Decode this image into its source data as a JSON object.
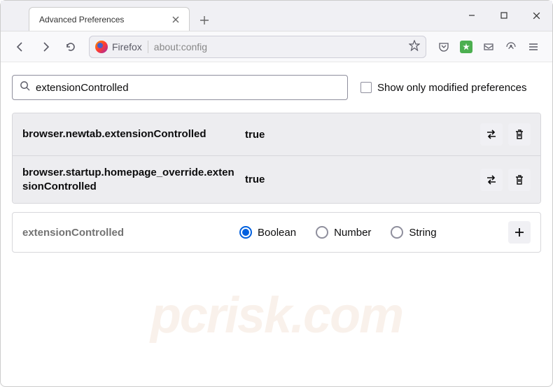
{
  "window": {
    "tab_title": "Advanced Preferences"
  },
  "toolbar": {
    "identity_label": "Firefox",
    "url": "about:config"
  },
  "search": {
    "value": "extensionControlled",
    "checkbox_label": "Show only modified preferences"
  },
  "prefs": [
    {
      "name": "browser.newtab.extensionControlled",
      "value": "true"
    },
    {
      "name": "browser.startup.homepage_override.extensionControlled",
      "value": "true"
    }
  ],
  "new_pref": {
    "name": "extensionControlled",
    "types": [
      "Boolean",
      "Number",
      "String"
    ],
    "selected": "Boolean"
  },
  "watermark": "pcrisk.com"
}
